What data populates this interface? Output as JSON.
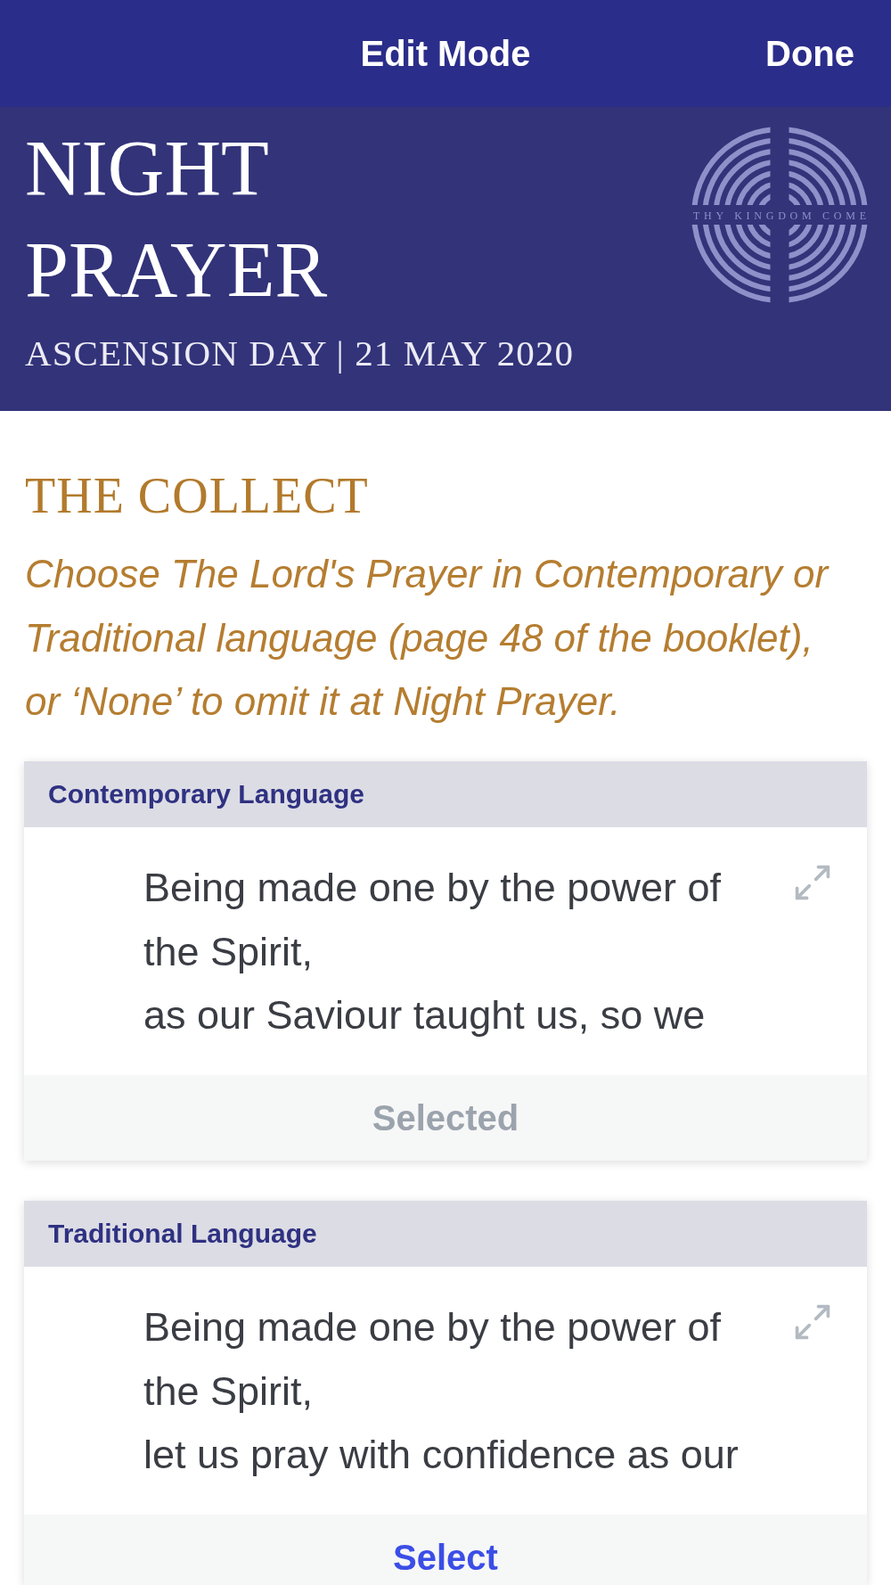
{
  "nav_bar": {
    "title": "Edit Mode",
    "done_button": "Done"
  },
  "header": {
    "title": "NIGHT PRAYER",
    "subtitle": "ASCENSION DAY | 21 MAY 2020",
    "logo_text": "THY KINGDOM COME"
  },
  "section": {
    "heading": "THE COLLECT",
    "instruction": "Choose The Lord's Prayer in Contemporary or Traditional language (page 48 of the booklet), or ‘None’ to omit it at Night Prayer."
  },
  "options": [
    {
      "title": "Contemporary Language",
      "lines": [
        "Being made one by the power of the Spirit,",
        "as our Saviour taught us, so we"
      ],
      "button_label": "Selected",
      "selected": true
    },
    {
      "title": "Traditional Language",
      "lines": [
        "Being made one by the power of the Spirit,",
        "let us pray with confidence as our"
      ],
      "button_label": "Select",
      "selected": false
    }
  ]
}
